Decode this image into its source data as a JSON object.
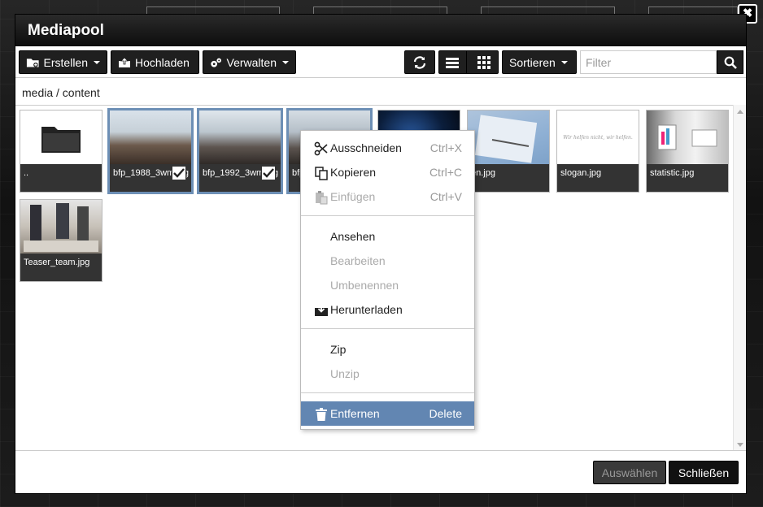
{
  "window": {
    "title": "Mediapool",
    "close_glyph": "✖"
  },
  "toolbar": {
    "create_label": "Erstellen",
    "upload_label": "Hochladen",
    "manage_label": "Verwalten",
    "sort_label": "Sortieren",
    "filter_placeholder": "Filter"
  },
  "breadcrumb": "media / content",
  "files": [
    {
      "label": "..",
      "type": "folder",
      "selected": false
    },
    {
      "label": "bfp_1988_3wm.jpg",
      "type": "image",
      "selected": true,
      "checked": true
    },
    {
      "label": "bfp_1992_3wm.jpg",
      "type": "image",
      "selected": true,
      "checked": true
    },
    {
      "label": "bfp",
      "type": "image",
      "selected": true
    },
    {
      "label": "",
      "type": "image",
      "selected": false
    },
    {
      "label": "en.jpg",
      "type": "image",
      "selected": false
    },
    {
      "label": "slogan.jpg",
      "type": "image",
      "selected": false,
      "thumb_text": "Wir helfen nicht, wir helfen."
    },
    {
      "label": "statistic.jpg",
      "type": "image",
      "selected": false
    },
    {
      "label": "Teaser_team.jpg",
      "type": "image",
      "selected": false
    }
  ],
  "context_menu": {
    "items": [
      {
        "label": "Ausschneiden",
        "shortcut": "Ctrl+X",
        "icon": "scissors-icon"
      },
      {
        "label": "Kopieren",
        "shortcut": "Ctrl+C",
        "icon": "copy-icon"
      },
      {
        "label": "Einfügen",
        "shortcut": "Ctrl+V",
        "icon": "paste-icon",
        "disabled": true
      },
      {
        "label": "Ansehen"
      },
      {
        "label": "Bearbeiten",
        "disabled": true
      },
      {
        "label": "Umbenennen",
        "disabled": true
      },
      {
        "label": "Herunterladen",
        "icon": "download-icon"
      },
      {
        "label": "Zip"
      },
      {
        "label": "Unzip",
        "disabled": true
      },
      {
        "label": "Entfernen",
        "shortcut": "Delete",
        "icon": "trash-icon",
        "active": true
      }
    ]
  },
  "footer": {
    "select_label": "Auswählen",
    "close_label": "Schließen"
  },
  "colors": {
    "selection": "#6d8fb5",
    "menu_active": "#6286b2",
    "toolbar": "#1f1f1f"
  }
}
